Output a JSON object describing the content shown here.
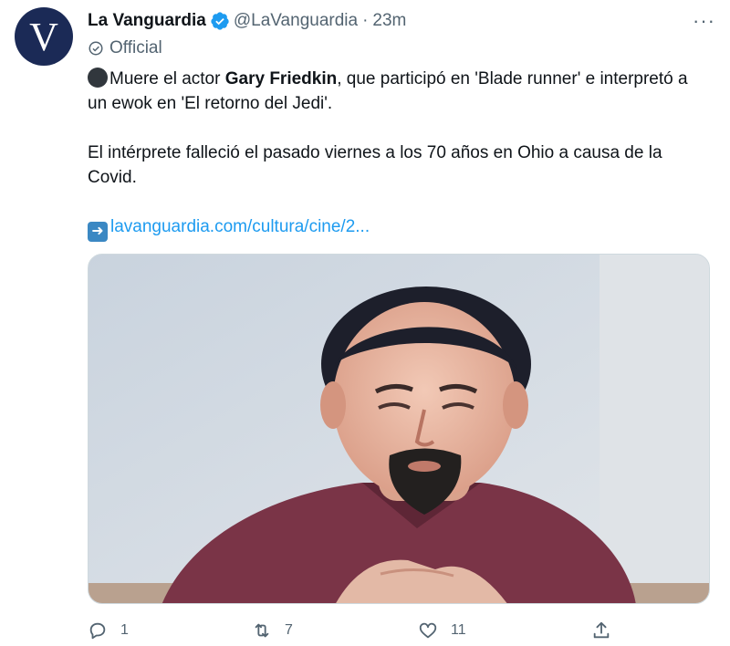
{
  "account": {
    "avatar_letter": "V",
    "name": "La Vanguardia",
    "handle": "@LaVanguardia",
    "separator": "·",
    "time": "23m",
    "badge_label": "Official",
    "more_label": "···"
  },
  "tweet": {
    "line1_before": "Muere el actor ",
    "line1_bold": "Gary Friedkin",
    "line1_after": ", que participó en 'Blade runner' e interpretó a un ewok en 'El retorno del Jedi'.",
    "paragraph2": "El intérprete falleció el pasado viernes a los 70 años en Ohio a causa de la Covid.",
    "link_text": "lavanguardia.com/cultura/cine/2..."
  },
  "actions": {
    "reply_count": "1",
    "retweet_count": "7",
    "like_count": "11"
  },
  "colors": {
    "link": "#1d9bf0",
    "verified": "#1d9bf0",
    "avatar_bg": "#1b2a56",
    "muted": "#536471"
  },
  "icons": [
    "verified-badge-icon",
    "official-badge-icon",
    "more-icon",
    "black-circle-emoji",
    "right-arrow-emoji",
    "reply-icon",
    "retweet-icon",
    "like-icon",
    "share-icon"
  ]
}
